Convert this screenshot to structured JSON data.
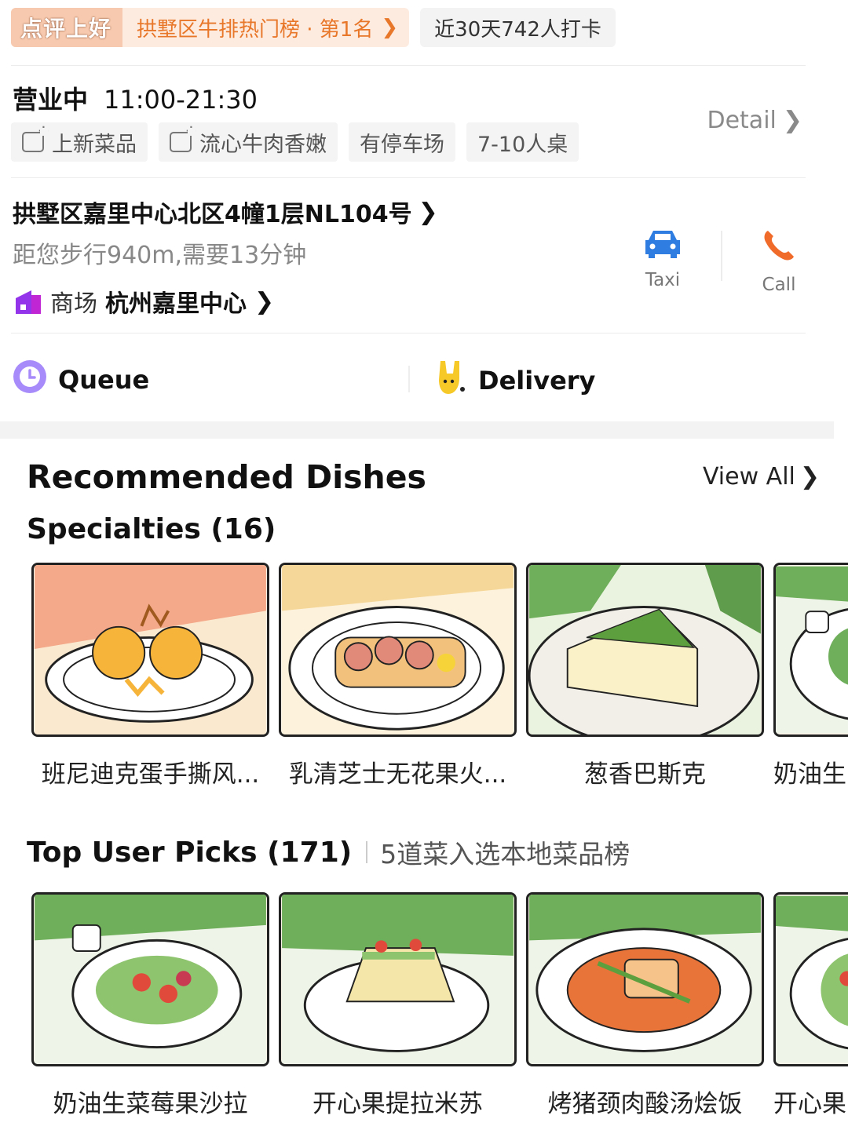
{
  "top": {
    "rank_logo": "点评上好",
    "rank_text": "拱墅区牛排热门榜 · 第1名",
    "checkin_text": "近30天742人打卡"
  },
  "hours": {
    "status": "营业中",
    "time": "11:00-21:30"
  },
  "tags": [
    "上新菜品",
    "流心牛肉香嫩",
    "有停车场",
    "7-10人桌"
  ],
  "detail_label": "Detail",
  "address": {
    "line": "拱墅区嘉里中心北区4幢1层NL104号",
    "distance": "距您步行940m,需要13分钟",
    "mall_type": "商场",
    "mall_name": "杭州嘉里中心"
  },
  "actions": {
    "taxi": "Taxi",
    "call": "Call"
  },
  "services": {
    "queue": "Queue",
    "delivery": "Delivery"
  },
  "recommended": {
    "title": "Recommended Dishes",
    "view_all": "View All",
    "specialties": {
      "title": "Specialties (16)",
      "dishes": [
        "班尼迪克蛋手撕风...",
        "乳清芝士无花果火...",
        "葱香巴斯克",
        "奶油生"
      ]
    },
    "top_picks": {
      "title": "Top User Picks (171)",
      "subtitle": "5道菜入选本地菜品榜",
      "dishes": [
        "奶油生菜莓果沙拉",
        "开心果提拉米苏",
        "烤猪颈肉酸汤烩饭",
        "开心果"
      ]
    }
  },
  "colors": {
    "accent_orange": "#e8772a",
    "taxi_blue": "#2f7de1",
    "call_orange": "#f06a2a",
    "queue_purple": "#a78bfa",
    "mall_purple": "#9333ea",
    "delivery_yellow": "#f7c928"
  }
}
